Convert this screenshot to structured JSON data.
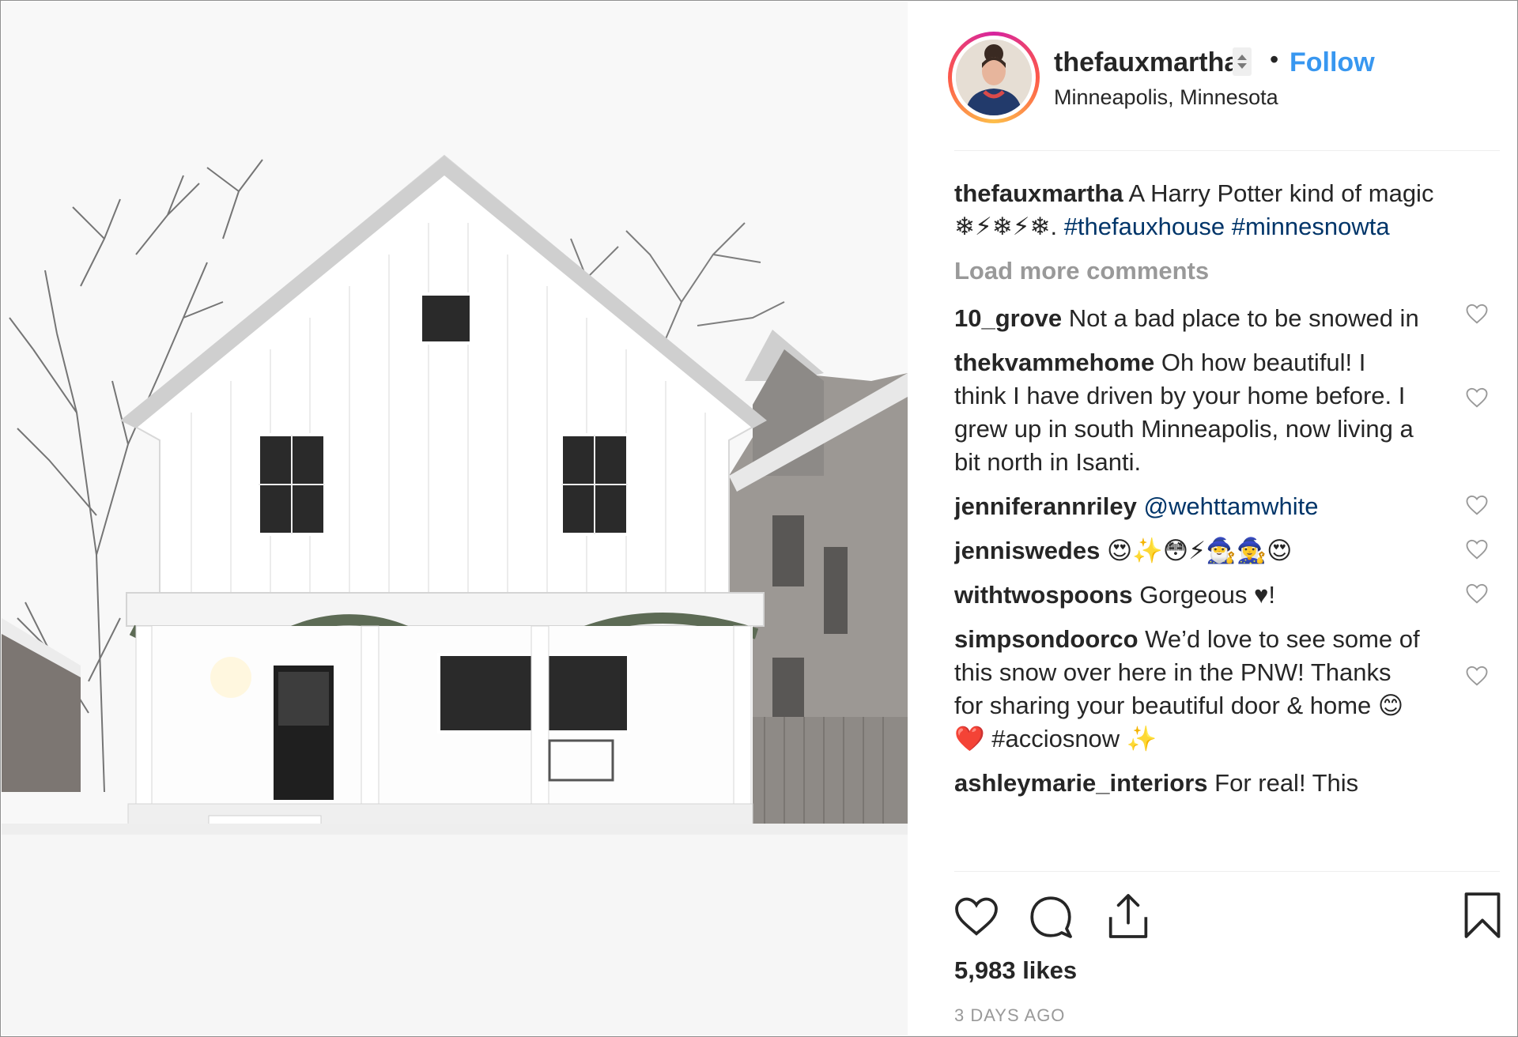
{
  "post": {
    "username": "thefauxmartha",
    "separator": "•",
    "follow_label": "Follow",
    "location": "Minneapolis, Minnesota",
    "image_alt": "White farmhouse with front porch and garland covered in falling snow"
  },
  "caption": {
    "username": "thefauxmartha",
    "text": "A Harry Potter kind of magic ❄⚡❄⚡❄. ",
    "hashtags": [
      "#thefauxhouse",
      "#minnesnowta"
    ]
  },
  "load_more_label": "Load more comments",
  "comments": [
    {
      "username": "10_grove",
      "text": "Not a bad place to be snowed in"
    },
    {
      "username": "thekvammehome",
      "text": "Oh how beautiful! I think I have driven by your home before. I grew up in south Minneapolis, now living a bit north in Isanti."
    },
    {
      "username": "jenniferannriley",
      "text": "@wehttamwhite"
    },
    {
      "username": "jenniswedes",
      "text": "😍✨😳⚡🧙‍♂️🧙‍♀️😍"
    },
    {
      "username": "withtwospoons",
      "text": "Gorgeous ♥!"
    },
    {
      "username": "simpsondoorco",
      "text": "We’d love to see some of this snow over here in the PNW! Thanks for sharing your beautiful door & home 😊❤️ #acciosnow ✨"
    },
    {
      "username": "ashleymarie_interiors",
      "text": "For real! This"
    }
  ],
  "actions": {
    "like_icon": "heart-icon",
    "comment_icon": "comment-bubble-icon",
    "share_icon": "share-icon",
    "save_icon": "bookmark-icon"
  },
  "likes_label": "5,983 likes",
  "timestamp": "3 DAYS AGO",
  "colors": {
    "follow": "#3897f0",
    "hashtag": "#003569",
    "muted": "#999999",
    "text": "#262626"
  }
}
